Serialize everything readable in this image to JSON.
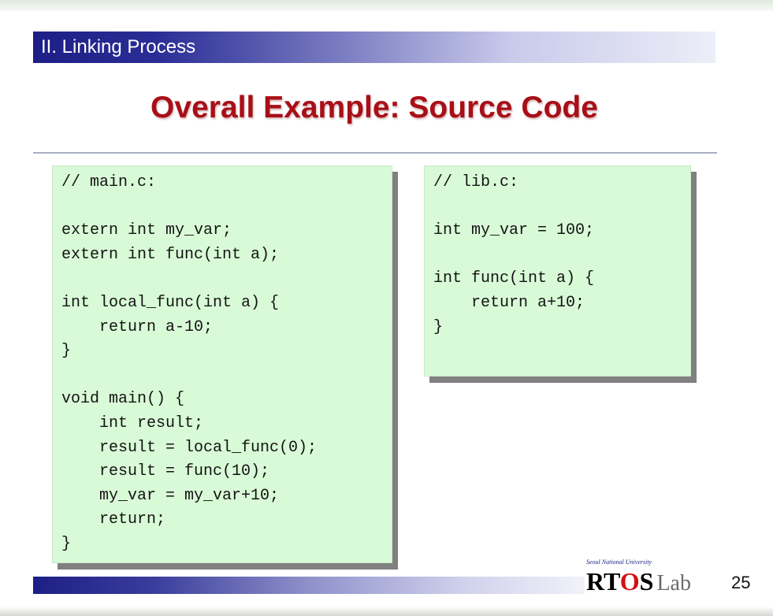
{
  "header": {
    "section_title": "II. Linking Process",
    "slide_title": "Overall Example: Source Code"
  },
  "code_panels": {
    "main": {
      "lines": [
        "// main.c:",
        "",
        "extern int my_var;",
        "extern int func(int a);",
        "",
        "int local_func(int a) {",
        "    return a-10;",
        "}",
        "",
        "void main() {",
        "    int result;",
        "    result = local_func(0);",
        "    result = func(10);",
        "    my_var = my_var+10;",
        "    return;",
        "}"
      ]
    },
    "lib": {
      "lines": [
        "// lib.c:",
        "",
        "int my_var = 100;",
        "",
        "int func(int a) {",
        "    return a+10;",
        "}"
      ]
    }
  },
  "footer": {
    "logo_small_text": "Seoul National University",
    "logo_rt": "RT",
    "logo_o": "O",
    "logo_s": "S",
    "logo_lab": "Lab",
    "page_number": "25"
  },
  "colors": {
    "title_red": "#a80f17",
    "bar_blue": "#1d1f86",
    "code_bg": "#d9fad7"
  }
}
